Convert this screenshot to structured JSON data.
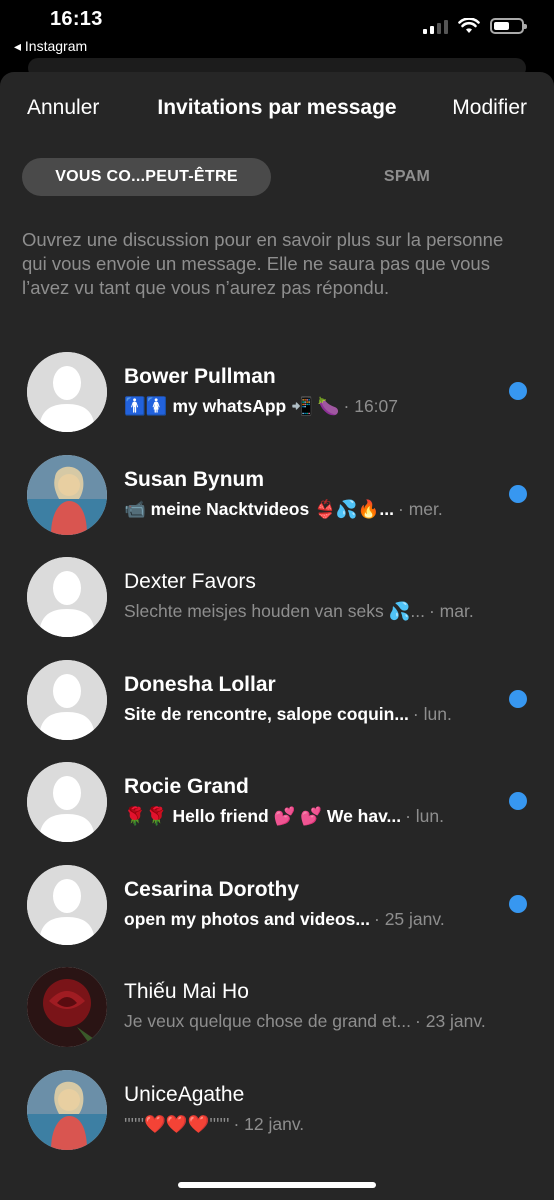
{
  "status_bar": {
    "time": "16:13",
    "back_app": "◂ Instagram"
  },
  "nav": {
    "cancel": "Annuler",
    "title": "Invitations par message",
    "edit": "Modifier"
  },
  "tabs": {
    "active": "VOUS CO...PEUT-ÊTRE",
    "inactive": "SPAM"
  },
  "notice": "Ouvrez une discussion pour en savoir plus sur la personne qui vous envoie un message. Elle ne saura pas que vous l’avez vu tant que vous n’aurez pas répondu.",
  "colors": {
    "unread_dot": "#3797f0",
    "sheet_bg": "#262626"
  },
  "requests": [
    {
      "name": "Bower Pullman",
      "preview": "🚹🚺 my whatsApp 📲  🍆",
      "time": "· 16:07",
      "unread": true,
      "avatar": "default-avatar-icon"
    },
    {
      "name": "Susan Bynum",
      "preview": "📹 meine Nacktvideos 👙💦🔥...",
      "time": "· mer.",
      "unread": true,
      "avatar": "photo-avatar"
    },
    {
      "name": "Dexter Favors",
      "preview": "Slechte meisjes houden van seks 💦...",
      "time": "· mar.",
      "unread": false,
      "avatar": "default-avatar-icon"
    },
    {
      "name": "Donesha Lollar",
      "preview": "Site de rencontre, salope coquin...",
      "time": "· lun.",
      "unread": true,
      "avatar": "default-avatar-icon"
    },
    {
      "name": "Rocie Grand",
      "preview": "🌹🌹 Hello friend 💕 💕 We hav...",
      "time": "· lun.",
      "unread": true,
      "avatar": "default-avatar-icon"
    },
    {
      "name": "Cesarina Dorothy",
      "preview": "open my photos and videos...",
      "time": "· 25 janv.",
      "unread": true,
      "avatar": "default-avatar-icon"
    },
    {
      "name": "Thiếu Mai Ho",
      "preview": "Je veux quelque chose de grand et...",
      "time": "· 23 janv.",
      "unread": false,
      "avatar": "rose-avatar"
    },
    {
      "name": "UniceAgathe",
      "preview": "''''''❤️❤️❤️''''''",
      "time": "· 12 janv.",
      "unread": false,
      "avatar": "photo-avatar"
    }
  ]
}
